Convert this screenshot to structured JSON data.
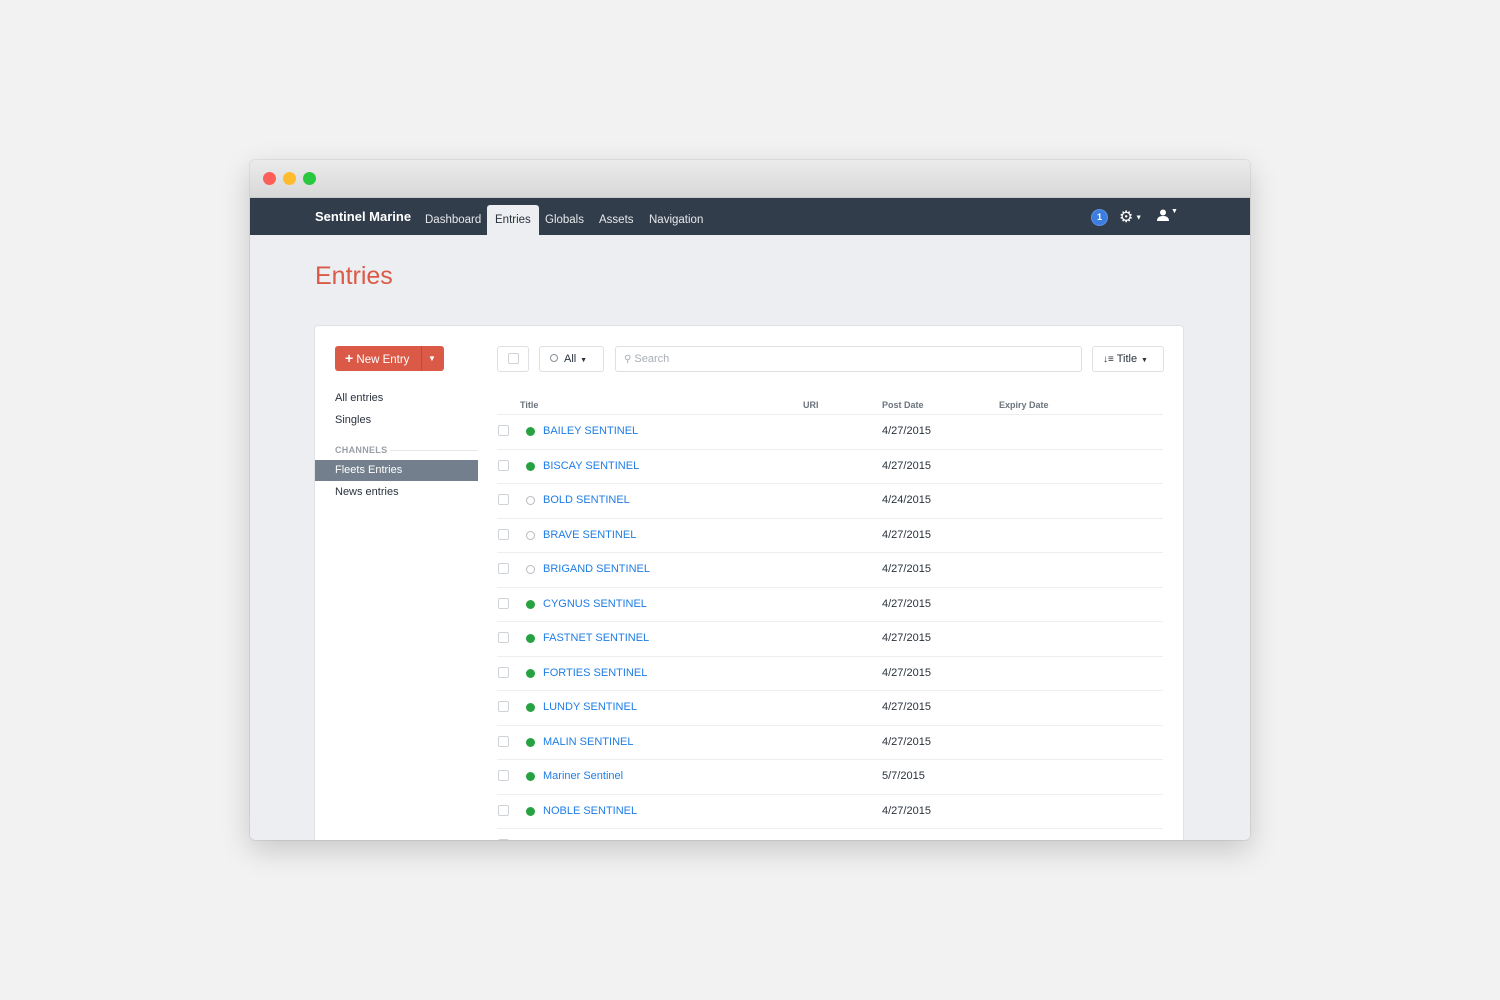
{
  "window": {
    "controls": [
      "close",
      "minimize",
      "zoom"
    ]
  },
  "nav": {
    "brand": "Sentinel Marine",
    "items": [
      "Dashboard",
      "Entries",
      "Globals",
      "Assets",
      "Navigation"
    ],
    "active": "Entries",
    "badge": "1"
  },
  "page": {
    "title": "Entries"
  },
  "toolbar": {
    "new_entry": "New Entry",
    "status_filter": "All",
    "search_placeholder": "Search",
    "sort": "Title"
  },
  "sidebar": {
    "items": [
      "All entries",
      "Singles"
    ],
    "heading": "CHANNELS",
    "channels": [
      "Fleets Entries",
      "News entries"
    ],
    "selected": "Fleets Entries"
  },
  "table": {
    "columns": [
      "Title",
      "URI",
      "Post Date",
      "Expiry Date"
    ],
    "rows": [
      {
        "title": "BAILEY SENTINEL",
        "status": "live",
        "post_date": "4/27/2015"
      },
      {
        "title": "BISCAY SENTINEL",
        "status": "live",
        "post_date": "4/27/2015"
      },
      {
        "title": "BOLD SENTINEL",
        "status": "disabled",
        "post_date": "4/24/2015"
      },
      {
        "title": "BRAVE SENTINEL",
        "status": "disabled",
        "post_date": "4/27/2015"
      },
      {
        "title": "BRIGAND SENTINEL",
        "status": "disabled",
        "post_date": "4/27/2015"
      },
      {
        "title": "CYGNUS SENTINEL",
        "status": "live",
        "post_date": "4/27/2015"
      },
      {
        "title": "FASTNET SENTINEL",
        "status": "live",
        "post_date": "4/27/2015"
      },
      {
        "title": "FORTIES SENTINEL",
        "status": "live",
        "post_date": "4/27/2015"
      },
      {
        "title": "LUNDY SENTINEL",
        "status": "live",
        "post_date": "4/27/2015"
      },
      {
        "title": "MALIN SENTINEL",
        "status": "live",
        "post_date": "4/27/2015"
      },
      {
        "title": "Mariner Sentinel",
        "status": "live",
        "post_date": "5/7/2015"
      },
      {
        "title": "NOBLE SENTINEL",
        "status": "live",
        "post_date": "4/27/2015"
      }
    ]
  },
  "colors": {
    "accent": "#da5a47",
    "nav_bg": "#323d4b",
    "link": "#1f7de6",
    "live": "#27a243",
    "selected_bg": "#737f8c"
  }
}
